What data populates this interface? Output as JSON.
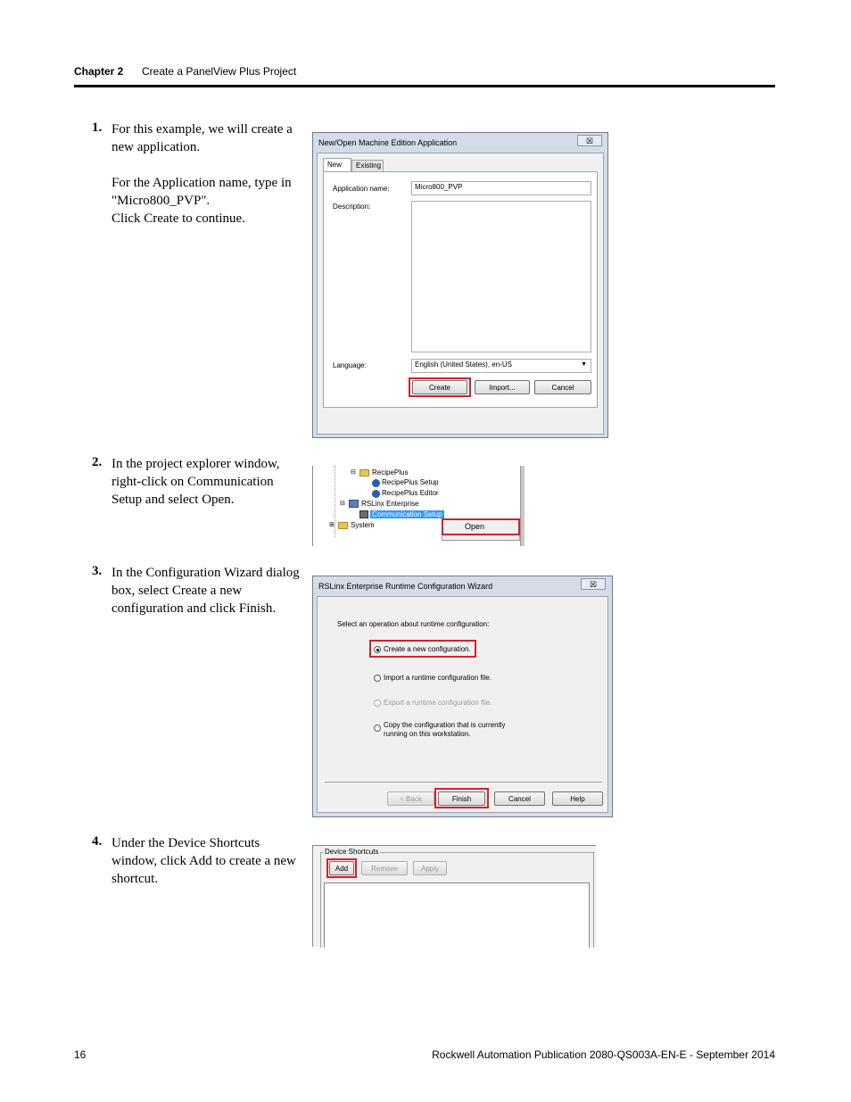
{
  "header": {
    "chapter": "Chapter 2",
    "title": "Create a PanelView Plus Project"
  },
  "footer": {
    "page": "16",
    "publication": "Rockwell Automation Publication 2080-QS003A-EN-E - September 2014"
  },
  "steps": [
    {
      "num": "1.",
      "paras": [
        "For this example, we will create a new application.",
        "For the Application name, type in \"Micro800_PVP\".",
        "Click Create to continue."
      ]
    },
    {
      "num": "2.",
      "paras": [
        "In the project explorer window, right-click on Communication Setup and select Open."
      ]
    },
    {
      "num": "3.",
      "paras": [
        "In the Configuration Wizard dialog box, select Create a new configuration and click Finish."
      ]
    },
    {
      "num": "4.",
      "paras": [
        "Under the Device Shortcuts window, click Add to create a new shortcut."
      ]
    }
  ],
  "dialog1": {
    "title": "New/Open Machine Edition Application",
    "close": "☒",
    "tabs": [
      "New",
      "Existing"
    ],
    "app_name_label": "Application name:",
    "app_name_value": "Micro800_PVP",
    "description_label": "Description:",
    "language_label": "Language:",
    "language_value": "English (United States), en-US",
    "buttons": {
      "create": "Create",
      "import": "Import...",
      "cancel": "Cancel"
    }
  },
  "tree": {
    "items": [
      "RecipePlus",
      "RecipePlus Setup",
      "RecipePlus Editor",
      "RSLinx Enterprise",
      "Communication Setup",
      "System"
    ],
    "context_menu": "Open"
  },
  "wizard": {
    "title": "RSLinx Enterprise Runtime Configuration Wizard",
    "close": "☒",
    "prompt": "Select an operation about runtime configuration:",
    "options": [
      "Create a new configuration.",
      "Import a runtime configuration file.",
      "Export a runtime configuration file.",
      "Copy the configuration that is currently running on this workstation."
    ],
    "buttons": {
      "back": "< Back",
      "finish": "Finish",
      "cancel": "Cancel",
      "help": "Help"
    }
  },
  "shortcuts": {
    "title": "Device Shortcuts",
    "buttons": {
      "add": "Add",
      "remove": "Remove",
      "apply": "Apply"
    }
  },
  "colors": {
    "highlight_red": "#d4202a",
    "selection_blue": "#3399ff"
  }
}
